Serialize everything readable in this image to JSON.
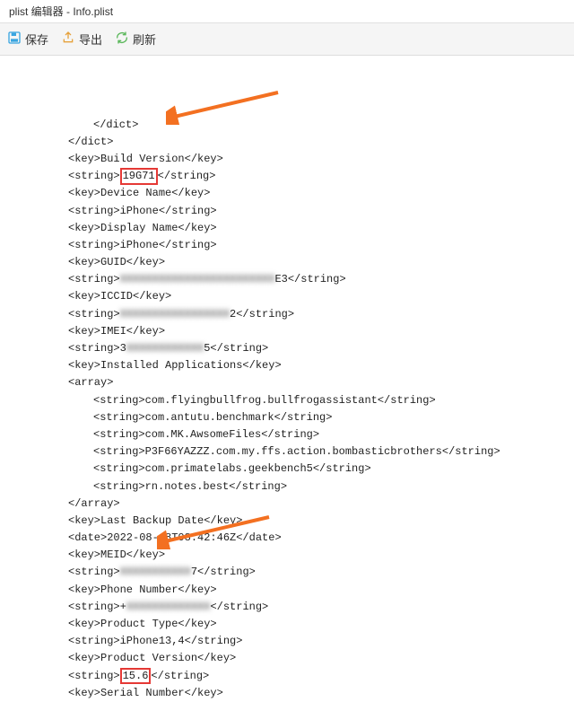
{
  "window": {
    "title": "plist 编辑器 - Info.plist"
  },
  "toolbar": {
    "save_label": "保存",
    "export_label": "导出",
    "refresh_label": "刷新"
  },
  "code": {
    "lines": [
      {
        "indent": 3,
        "text": "</dict>"
      },
      {
        "indent": 2,
        "text": "</dict>"
      },
      {
        "indent": 2,
        "text": "<key>Build Version</key>"
      },
      {
        "indent": 2,
        "text": "<string>",
        "boxed": "19G71",
        "text2": "</string>",
        "highlight": true
      },
      {
        "indent": 2,
        "text": "<key>Device Name</key>"
      },
      {
        "indent": 2,
        "text": "<string>iPhone</string>"
      },
      {
        "indent": 2,
        "text": "<key>Display Name</key>"
      },
      {
        "indent": 2,
        "text": "<string>iPhone</string>"
      },
      {
        "indent": 2,
        "text": "<key>GUID</key>"
      },
      {
        "indent": 2,
        "text": "<string>",
        "blur": "XXXXXXXXXXXXXXXXXXXXXXXX",
        "text2": "E3</string>"
      },
      {
        "indent": 2,
        "text": "<key>ICCID</key>"
      },
      {
        "indent": 2,
        "text": "<string>",
        "blur": "XXXXXXXXXXXXXXXXX",
        "text2": "2</string>"
      },
      {
        "indent": 2,
        "text": "<key>IMEI</key>"
      },
      {
        "indent": 2,
        "text": "<string>3",
        "blur": "XXXXXXXXXXXX",
        "text2": "5</string>"
      },
      {
        "indent": 2,
        "text": "<key>Installed Applications</key>"
      },
      {
        "indent": 2,
        "text": "<array>"
      },
      {
        "indent": 3,
        "text": "<string>com.flyingbullfrog.bullfrogassistant</string>"
      },
      {
        "indent": 3,
        "text": "<string>com.antutu.benchmark</string>"
      },
      {
        "indent": 3,
        "text": "<string>com.MK.AwsomeFiles</string>"
      },
      {
        "indent": 3,
        "text": "<string>P3F66YAZZZ.com.my.ffs.action.bombasticbrothers</string>"
      },
      {
        "indent": 3,
        "text": "<string>com.primatelabs.geekbench5</string>"
      },
      {
        "indent": 3,
        "text": "<string>rn.notes.best</string>"
      },
      {
        "indent": 2,
        "text": "</array>"
      },
      {
        "indent": 2,
        "text": "<key>Last Backup Date</key>"
      },
      {
        "indent": 2,
        "text": "<date>2022-08-18T08:42:46Z</date>"
      },
      {
        "indent": 2,
        "text": "<key>MEID</key>"
      },
      {
        "indent": 2,
        "text": "<string>",
        "blur": "XXXXXXXXXXX",
        "text2": "7</string>"
      },
      {
        "indent": 2,
        "text": "<key>Phone Number</key>"
      },
      {
        "indent": 2,
        "text": "<string>+",
        "blur": "XXXXXXXXXXXXX",
        "text2": "</string>"
      },
      {
        "indent": 2,
        "text": "<key>Product Type</key>"
      },
      {
        "indent": 2,
        "text": "<string>iPhone13,4</string>"
      },
      {
        "indent": 2,
        "text": "<key>Product Version</key>"
      },
      {
        "indent": 2,
        "text": "<string>",
        "boxed": "15.6",
        "text2": "</string>",
        "highlight": true
      },
      {
        "indent": 2,
        "text": "<key>Serial Number</key>"
      }
    ]
  }
}
